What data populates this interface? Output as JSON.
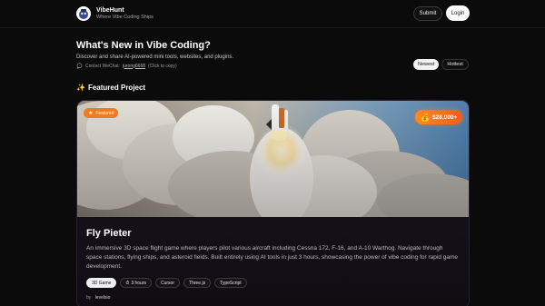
{
  "header": {
    "app_name": "VibeHunt",
    "tagline": "Where Vibe Coding Ships",
    "submit_label": "Submit",
    "login_label": "Login"
  },
  "intro": {
    "headline": "What's New in Vibe Coding?",
    "subline": "Discover and share AI-powered mini tools, websites, and plugins.",
    "contact_prefix": "Contact WeChat:",
    "wechat_id": "jurong6668",
    "contact_suffix": "(Click to copy)"
  },
  "sort": {
    "options": [
      "Newest",
      "Hottest"
    ],
    "selected": "Newest"
  },
  "featured": {
    "section_title": "Featured Project",
    "section_icon": "sparkles-icon",
    "badge_label": "Featured",
    "price": "$28,000+",
    "project": {
      "title": "Fly Pieter",
      "description": "An immersive 3D space flight game where players pilot various aircraft including Cessna 172, F-16, and A-10 Warthog. Navigate through space stations, flying ships, and asteroid fields. Built entirely using AI tools in just 3 hours, showcasing the power of vibe coding for rapid game development.",
      "tags": [
        "3D Game",
        "3 hours",
        "Cursor",
        "Three.js",
        "TypeScript"
      ],
      "author_prefix": "by",
      "author": "levelsio"
    }
  },
  "colors": {
    "background": "#0b0b0c",
    "featured_badge": "#f27b1f",
    "price_badge": "#ff8a1d"
  }
}
